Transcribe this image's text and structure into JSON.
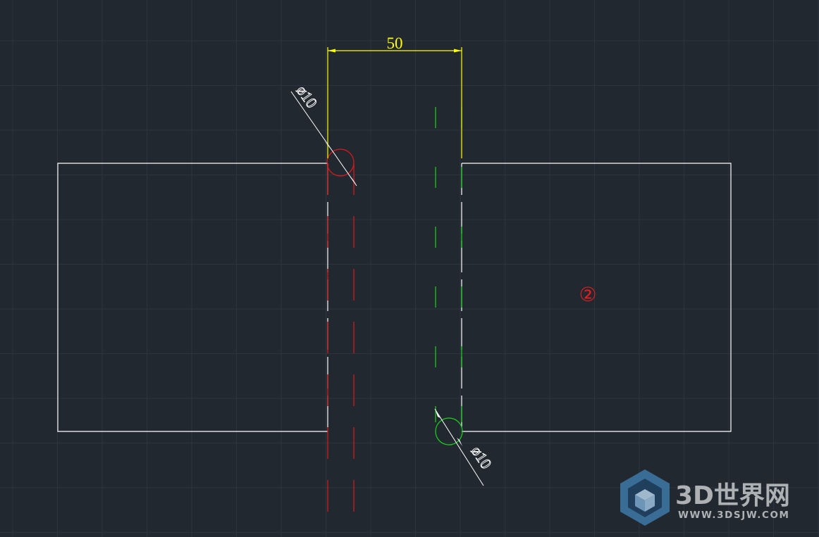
{
  "drawing": {
    "dimension_top": "50",
    "diameter_red": "ø10",
    "diameter_green": "ø10",
    "part_marker": "②"
  },
  "watermark": {
    "brand": "3D世界网",
    "url": "WWW.3DSJW.COM"
  },
  "colors": {
    "background": "#212830",
    "grid": "#2d3440",
    "outline": "#ffffff",
    "dimension": "#ffff00",
    "hole_red": "#e01919",
    "hole_green": "#19d419",
    "marker": "#e02020",
    "watermark": "#5a93c0"
  }
}
